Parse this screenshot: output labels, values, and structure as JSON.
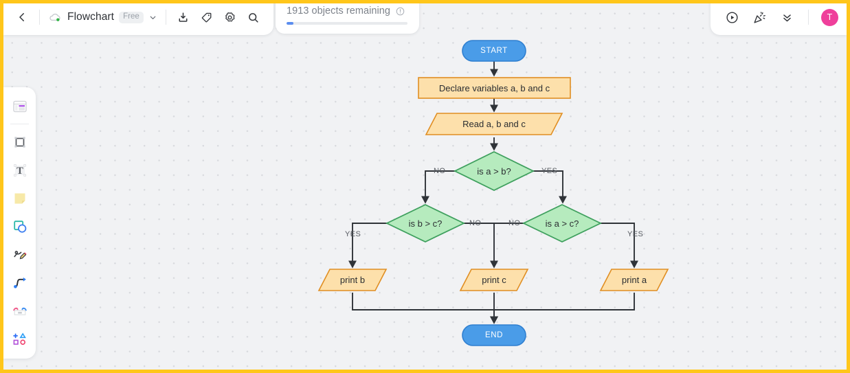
{
  "window": {
    "border_color": "#FFC61A",
    "canvas_bg": "#f1f2f4"
  },
  "topbar": {
    "back_icon": "chevron-left-icon",
    "cloud_icon": "cloud-sync-icon",
    "doc_title": "Flowchart",
    "plan_badge": "Free",
    "dropdown_icon": "chevron-down-icon",
    "actions": [
      {
        "name": "import-icon",
        "title": "Import"
      },
      {
        "name": "tag-icon",
        "title": "Tag"
      },
      {
        "name": "settings-gear-icon",
        "title": "Settings"
      },
      {
        "name": "search-icon",
        "title": "Search"
      }
    ],
    "objects": {
      "label": "1913 objects remaining",
      "info_icon": "info-circle-icon",
      "progress_percent": 5.5,
      "fill_color": "#5b8def",
      "track_color": "#e8eaed"
    },
    "right_actions": [
      {
        "name": "present-play-icon",
        "title": "Present"
      },
      {
        "name": "celebrate-icon",
        "title": "Celebrate"
      },
      {
        "name": "double-chevron-down-icon",
        "title": "Collapse"
      }
    ],
    "avatar": {
      "initial": "T",
      "color": "#ef3f9b"
    }
  },
  "tool_rail": {
    "items": [
      {
        "name": "templates-icon",
        "title": "Templates"
      },
      {
        "name": "select-frame-icon",
        "title": "Frame"
      },
      {
        "name": "text-icon",
        "title": "Text"
      },
      {
        "name": "sticky-note-icon",
        "title": "Sticky note"
      },
      {
        "name": "shapes-icon",
        "title": "Shapes"
      },
      {
        "name": "pen-draw-icon",
        "title": "Draw"
      },
      {
        "name": "curve-connector-icon",
        "title": "Connector"
      },
      {
        "name": "table-icon",
        "title": "Table"
      },
      {
        "name": "more-shapes-icon",
        "title": "More"
      }
    ]
  },
  "flowchart": {
    "colors": {
      "terminator_fill": "#4a9ce8",
      "terminator_stroke": "#2f7fd0",
      "process_fill": "#fde0ab",
      "process_stroke": "#e08e22",
      "decision_fill": "#b6ebbe",
      "decision_stroke": "#3fa05e",
      "edge": "#2f3338"
    },
    "nodes": [
      {
        "id": "start",
        "type": "terminator",
        "label": "START"
      },
      {
        "id": "declare",
        "type": "process",
        "label": "Declare variables a, b and c"
      },
      {
        "id": "read",
        "type": "io",
        "label": "Read a, b and c"
      },
      {
        "id": "dec_ab",
        "type": "decision",
        "label": "is a > b?"
      },
      {
        "id": "dec_bc",
        "type": "decision",
        "label": "is b > c?"
      },
      {
        "id": "dec_ac",
        "type": "decision",
        "label": "is a > c?"
      },
      {
        "id": "print_b",
        "type": "io",
        "label": "print b"
      },
      {
        "id": "print_c",
        "type": "io",
        "label": "print c"
      },
      {
        "id": "print_a",
        "type": "io",
        "label": "print a"
      },
      {
        "id": "end",
        "type": "terminator",
        "label": "END"
      }
    ],
    "edge_labels": [
      {
        "id": "ab_no",
        "text": "NO"
      },
      {
        "id": "ab_yes",
        "text": "YES"
      },
      {
        "id": "bc_yes",
        "text": "YES"
      },
      {
        "id": "bc_no",
        "text": "NO"
      },
      {
        "id": "ac_no",
        "text": "NO"
      },
      {
        "id": "ac_yes",
        "text": "YES"
      }
    ]
  }
}
